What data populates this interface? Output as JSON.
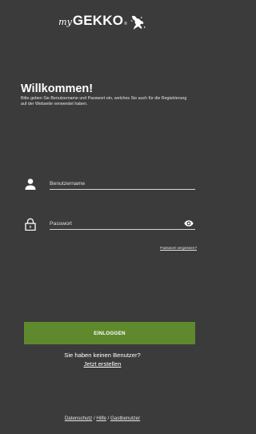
{
  "logo": {
    "prefix": "my",
    "brand": "GEKKO",
    "registered": "®"
  },
  "welcome": {
    "title": "Willkommen!",
    "text": "Bitte geben Sie Benutzername und Passwort ein, welches Sie auch für die Registrierung auf der Webseite verwendet haben."
  },
  "form": {
    "username_placeholder": "Benutzername",
    "password_placeholder": "Passwort",
    "forgot_label": "Passwort vergessen?",
    "login_label": "EINLOGGEN"
  },
  "signup": {
    "question": "Sie haben keinen Benutzer?",
    "link_label": "Jetzt erstellen"
  },
  "footer": {
    "privacy": "Datenschutz",
    "separator1": " / ",
    "help": "Hilfe",
    "separator2": " / ",
    "guest": "Gastbenutzer"
  },
  "colors": {
    "background": "#3b3b3b",
    "accent": "#5e8a2d"
  }
}
